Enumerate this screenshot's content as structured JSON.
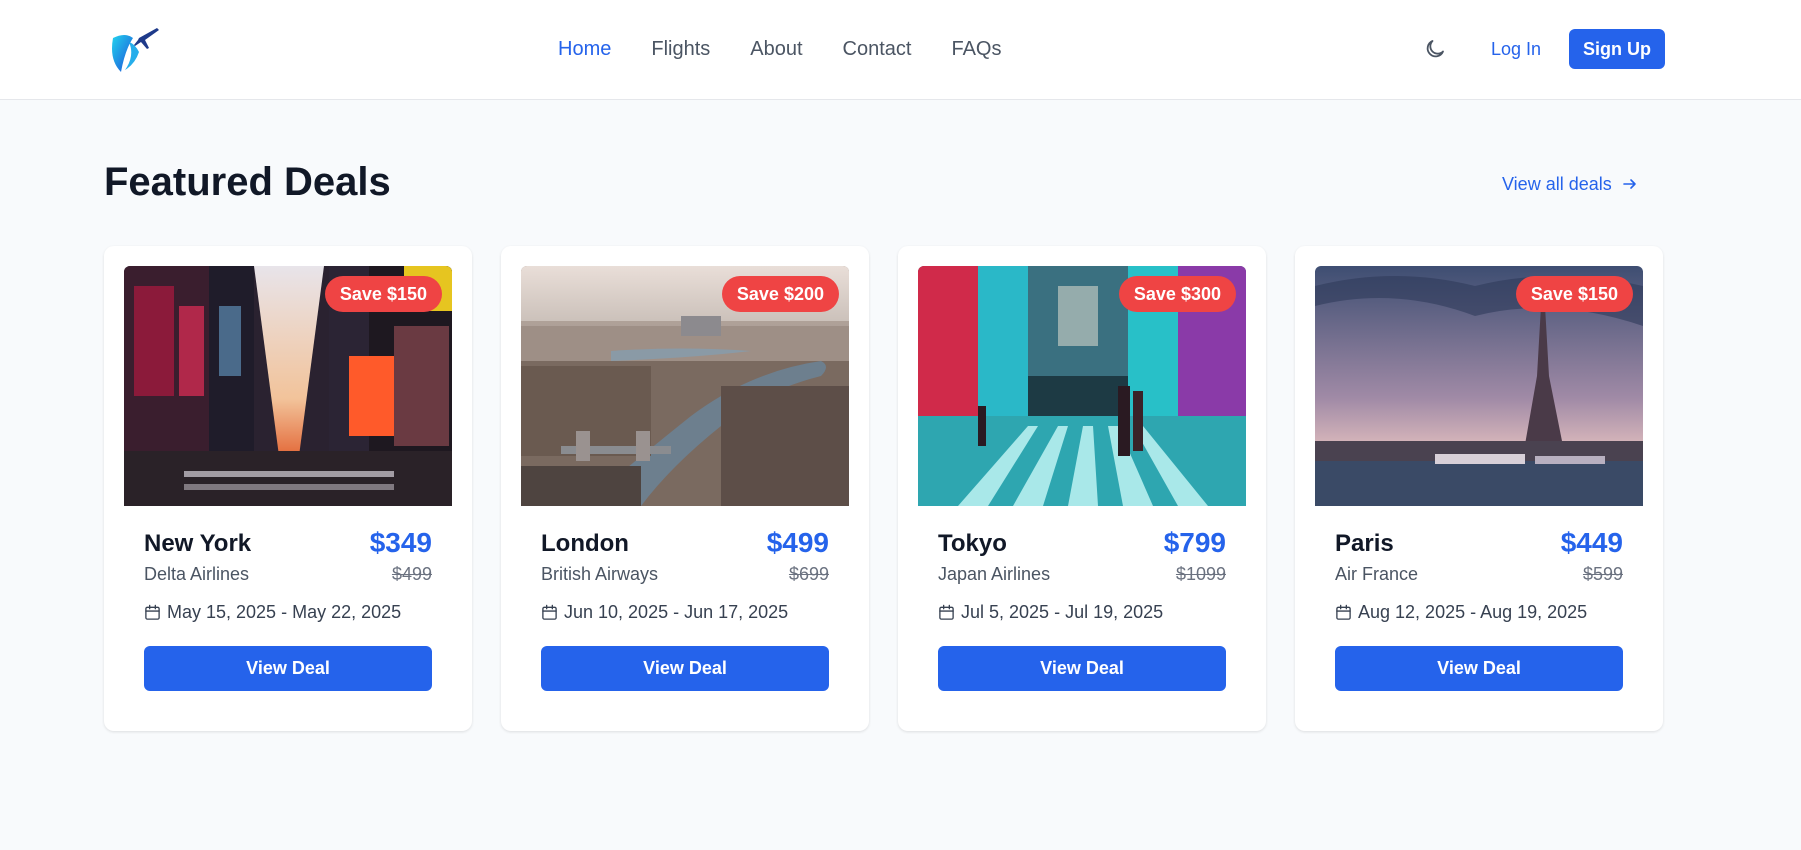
{
  "nav": {
    "links": [
      "Home",
      "Flights",
      "About",
      "Contact",
      "FAQs"
    ],
    "active": "Home",
    "login_label": "Log In",
    "signup_label": "Sign Up",
    "theme_icon": "moon-icon"
  },
  "section": {
    "title": "Featured Deals",
    "view_all_label": "View all deals",
    "view_all_icon": "arrow-right-icon"
  },
  "deals": [
    {
      "city": "New York",
      "airline": "Delta Airlines",
      "price": "$349",
      "old_price": "$499",
      "dates": "May 15, 2025 - May 22, 2025",
      "badge": "Save $150",
      "button": "View Deal"
    },
    {
      "city": "London",
      "airline": "British Airways",
      "price": "$499",
      "old_price": "$699",
      "dates": "Jun 10, 2025 - Jun 17, 2025",
      "badge": "Save $200",
      "button": "View Deal"
    },
    {
      "city": "Tokyo",
      "airline": "Japan Airlines",
      "price": "$799",
      "old_price": "$1099",
      "dates": "Jul 5, 2025 - Jul 19, 2025",
      "badge": "Save $300",
      "button": "View Deal"
    },
    {
      "city": "Paris",
      "airline": "Air France",
      "price": "$449",
      "old_price": "$599",
      "dates": "Aug 12, 2025 - Aug 19, 2025",
      "badge": "Save $150",
      "button": "View Deal"
    }
  ],
  "colors": {
    "accent": "#2563eb",
    "badge": "#ef4444",
    "background": "#f8fafc"
  }
}
